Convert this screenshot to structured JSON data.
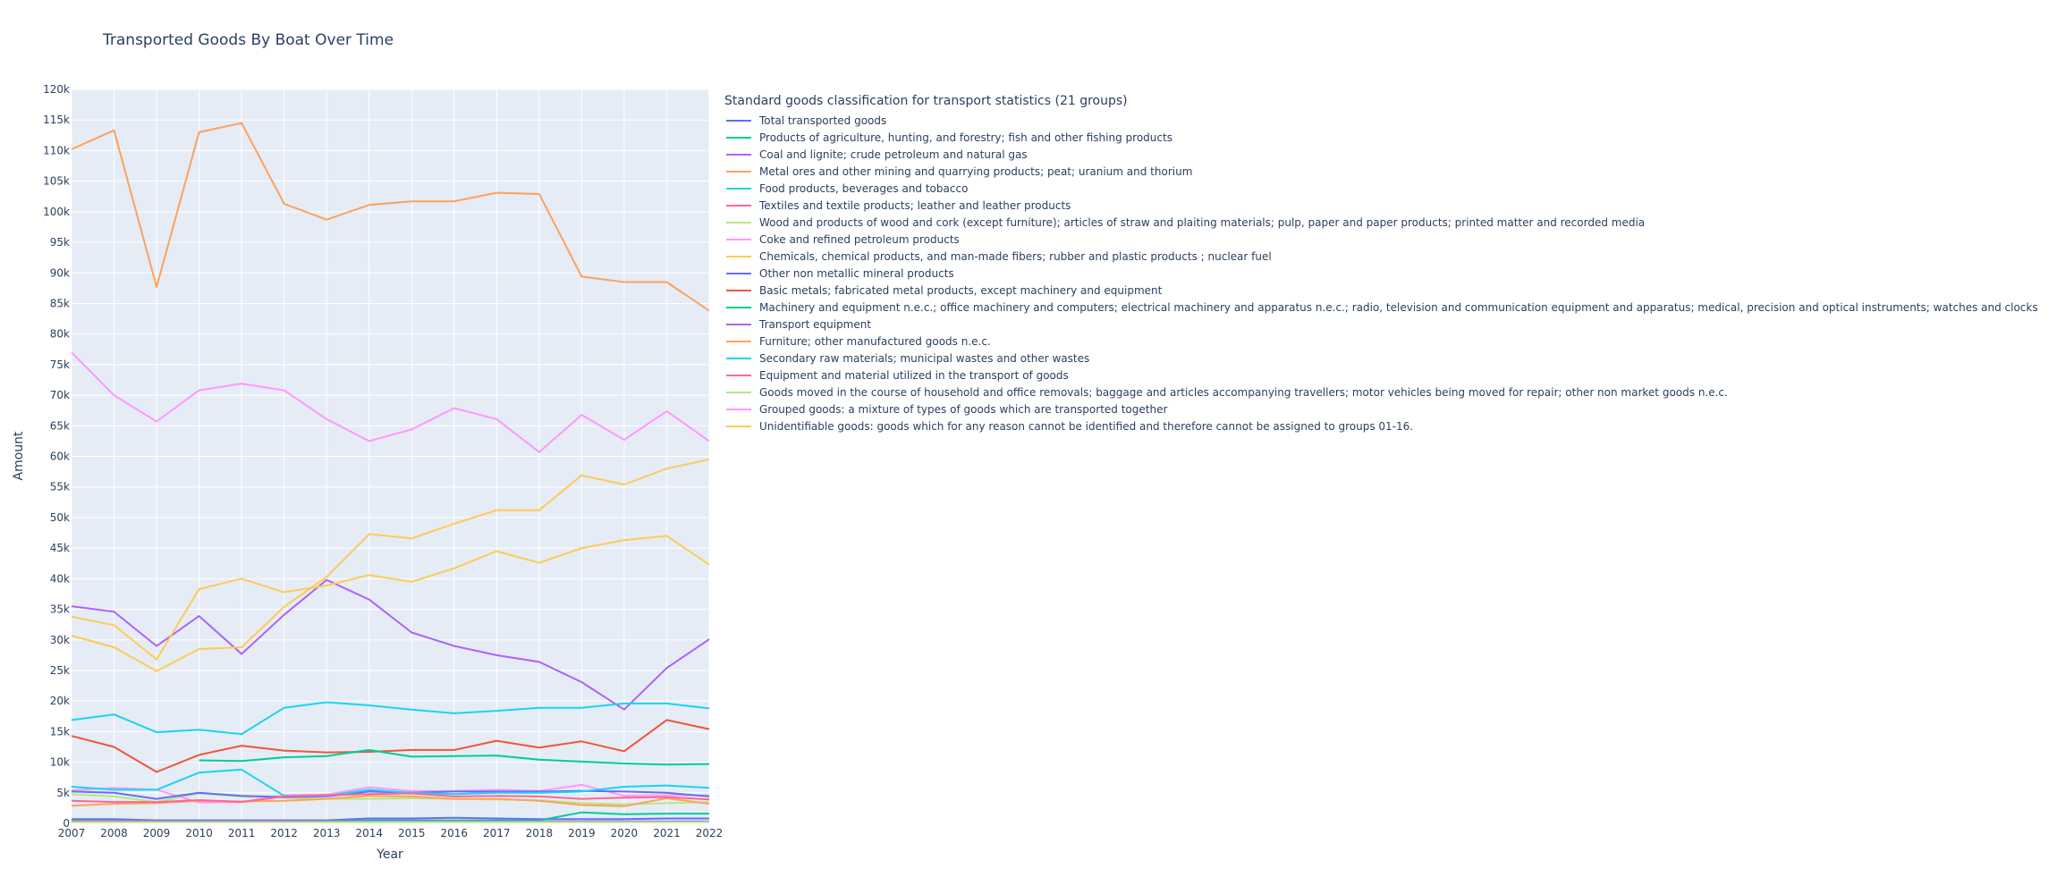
{
  "chart_data": {
    "type": "line",
    "title": "Transported Goods By Boat Over Time",
    "xlabel": "Year",
    "ylabel": "Amount",
    "xlim": [
      2007,
      2022
    ],
    "ylim": [
      0,
      120000
    ],
    "x_ticks": [
      "2007",
      "2008",
      "2009",
      "2010",
      "2011",
      "2012",
      "2013",
      "2014",
      "2015",
      "2016",
      "2017",
      "2018",
      "2019",
      "2020",
      "2021",
      "2022"
    ],
    "y_ticks": [
      "0",
      "5k",
      "10k",
      "15k",
      "20k",
      "25k",
      "30k",
      "35k",
      "40k",
      "45k",
      "50k",
      "55k",
      "60k",
      "65k",
      "70k",
      "75k",
      "80k",
      "85k",
      "90k",
      "95k",
      "100k",
      "105k",
      "110k",
      "115k",
      "120k"
    ],
    "grid": true,
    "legend_title": "Standard goods classification for transport statistics (21 groups)",
    "legend_position": "right",
    "x": [
      2007,
      2008,
      2009,
      2010,
      2011,
      2012,
      2013,
      2014,
      2015,
      2016,
      2017,
      2018,
      2019,
      2020,
      2021,
      2022
    ],
    "series": [
      {
        "name": "Total transported goods",
        "color": "#636efa",
        "values": [
          700,
          700,
          500,
          500,
          500,
          500,
          500,
          800,
          800,
          900,
          800,
          700,
          700,
          700,
          800,
          800
        ]
      },
      {
        "name": "Products of agriculture, hunting, and forestry; fish and other fishing products",
        "color": "#00cc96",
        "values": [
          500,
          500,
          300,
          300,
          300,
          300,
          400,
          500,
          500,
          500,
          500,
          500,
          1800,
          1500,
          1600,
          1600
        ]
      },
      {
        "name": "Coal and lignite; crude petroleum and natural gas",
        "color": "#ab63fa",
        "values": [
          35500,
          34600,
          29000,
          33900,
          27700,
          34100,
          39800,
          36600,
          31200,
          29000,
          27500,
          26400,
          23100,
          18600,
          25400,
          30100
        ]
      },
      {
        "name": "Metal ores and other mining and quarrying products; peat; uranium and thorium",
        "color": "#ffa15a",
        "values": [
          110200,
          113300,
          87700,
          113000,
          114500,
          101300,
          98700,
          101100,
          101700,
          101700,
          103100,
          102900,
          89400,
          88500,
          88500,
          83800
        ]
      },
      {
        "name": "Food products, beverages and tobacco",
        "color": "#19d3f3",
        "values": [
          16900,
          17800,
          14900,
          15300,
          14600,
          18900,
          19800,
          19300,
          18600,
          18000,
          18400,
          18900,
          18900,
          19600,
          19600,
          18800
        ]
      },
      {
        "name": "Textiles and textile products; leather and leather products",
        "color": "#ff6692",
        "values": [
          400,
          400,
          300,
          300,
          300,
          300,
          300,
          300,
          300,
          300,
          300,
          300,
          300,
          300,
          300,
          300
        ]
      },
      {
        "name": "Wood and products of wood and cork (except furniture); articles of straw and plaiting materials; pulp, paper and paper products; printed matter and recorded media",
        "color": "#b6e880",
        "values": [
          4800,
          4400,
          3500,
          4900,
          4400,
          4200,
          4000,
          4000,
          4100,
          4000,
          3900,
          3800,
          3300,
          3100,
          3300,
          3500
        ]
      },
      {
        "name": "Coke and refined petroleum products",
        "color": "#ff97ff",
        "values": [
          5400,
          5800,
          5500,
          3400,
          3500,
          4600,
          4700,
          5900,
          5300,
          5300,
          5500,
          5300,
          6300,
          4500,
          4600,
          4600
        ]
      },
      {
        "name": "Chemicals, chemical products, and man-made fibers; rubber and plastic products ; nuclear fuel",
        "color": "#fecb52",
        "values": [
          30700,
          28800,
          24900,
          28500,
          28800,
          35400,
          40300,
          47300,
          46600,
          49000,
          51200,
          51200,
          56900,
          55400,
          58000,
          59500
        ]
      },
      {
        "name": "Other non metallic mineral products",
        "color": "#636efa",
        "values": [
          5200,
          5000,
          4000,
          5000,
          4500,
          4300,
          4400,
          5200,
          5000,
          5200,
          5200,
          5200,
          5300,
          5200,
          5000,
          4400
        ]
      },
      {
        "name": "Basic metals; fabricated metal products, except machinery and equipment",
        "color": "#ef553b",
        "values": [
          14300,
          12500,
          8400,
          11200,
          12700,
          11900,
          11600,
          11700,
          12000,
          12000,
          13500,
          12400,
          13400,
          11800,
          16900,
          15400
        ]
      },
      {
        "name": "Machinery and equipment n.e.c.; office machinery and computers; electrical machinery and apparatus n.e.c.; radio, television and communication equipment and apparatus; medical, precision and optical instruments; watches and clocks",
        "color": "#00cc96",
        "values": [
          null,
          null,
          null,
          10300,
          10200,
          10800,
          11000,
          12000,
          10900,
          11000,
          11100,
          10400,
          10100,
          9800,
          9600,
          9700
        ]
      },
      {
        "name": "Transport equipment",
        "color": "#ab63fa",
        "values": [
          300,
          300,
          300,
          300,
          300,
          300,
          300,
          300,
          300,
          300,
          300,
          300,
          300,
          300,
          300,
          300
        ]
      },
      {
        "name": "Furniture; other manufactured goods n.e.c.",
        "color": "#ffa15a",
        "values": [
          2900,
          3200,
          3300,
          3700,
          3600,
          3700,
          4000,
          4500,
          4400,
          4000,
          4000,
          3700,
          3000,
          2800,
          4100,
          3200
        ]
      },
      {
        "name": "Secondary raw materials; municipal wastes and other wastes",
        "color": "#19d3f3",
        "values": [
          6000,
          5500,
          5500,
          8300,
          8800,
          4500,
          4500,
          5500,
          5000,
          4800,
          5000,
          5000,
          5200,
          6000,
          6200,
          5800
        ]
      },
      {
        "name": "Equipment and material utilized in the transport of goods",
        "color": "#ff6692",
        "values": [
          3700,
          3500,
          3500,
          3800,
          3500,
          4400,
          4600,
          4800,
          4900,
          4400,
          4500,
          4400,
          4000,
          4200,
          4300,
          3900
        ]
      },
      {
        "name": "Goods moved in the course of household and office removals; baggage and articles accompanying travellers; motor vehicles being moved for repair; other non market goods n.e.c.",
        "color": "#b6e880",
        "values": [
          200,
          200,
          200,
          200,
          200,
          200,
          200,
          200,
          200,
          200,
          200,
          200,
          200,
          200,
          200,
          200
        ]
      },
      {
        "name": "Grouped goods: a mixture of types of goods which are transported together",
        "color": "#ff97ff",
        "values": [
          77000,
          70000,
          65700,
          70800,
          71900,
          70800,
          66100,
          62500,
          64400,
          67900,
          66100,
          60700,
          66800,
          62700,
          67400,
          62500
        ]
      },
      {
        "name": "Unidentifiable goods: goods which for any reason cannot be identified and therefore cannot be assigned to groups 01-16.",
        "color": "#fecb52",
        "values": [
          33800,
          32400,
          26800,
          38300,
          40000,
          37800,
          38900,
          40600,
          39500,
          41700,
          44500,
          42600,
          45000,
          46300,
          47000,
          42300
        ]
      }
    ]
  }
}
